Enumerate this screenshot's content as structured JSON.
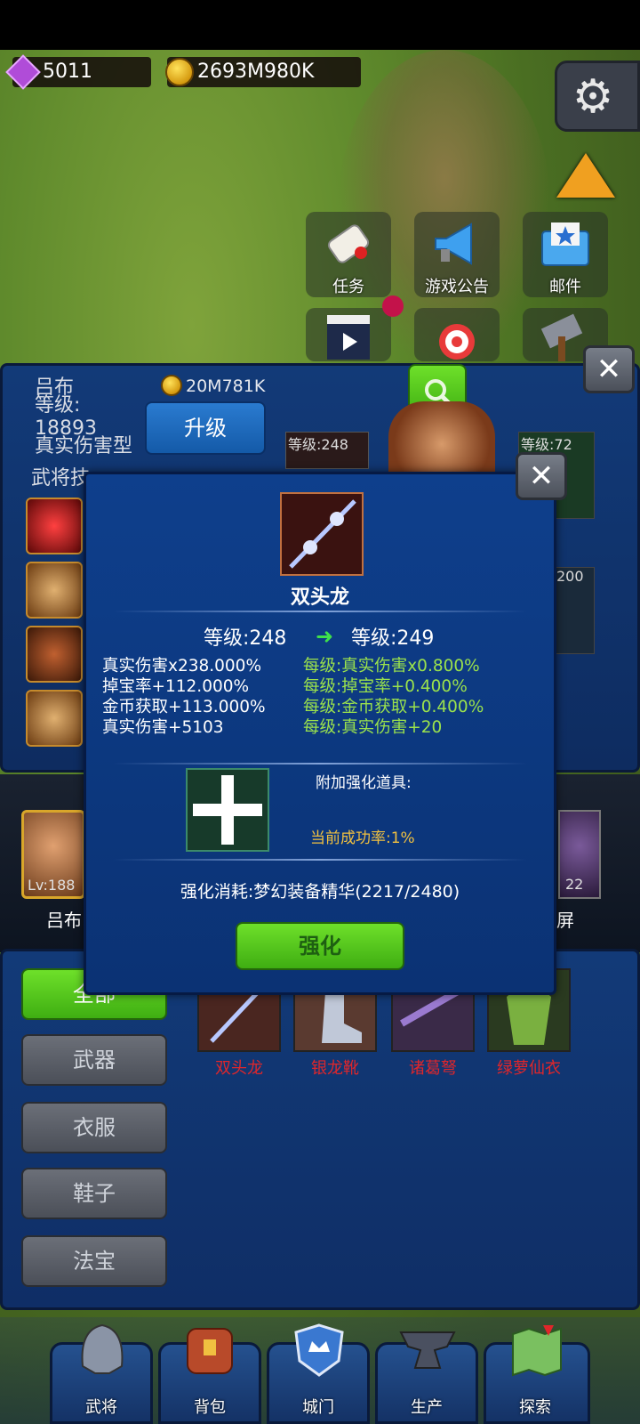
{
  "resources": {
    "gems": "5011",
    "gold": "2693M980K"
  },
  "menu_tiles": [
    {
      "label": "任务",
      "icon": "scroll-icon"
    },
    {
      "label": "游戏公告",
      "icon": "megaphone-icon"
    },
    {
      "label": "邮件",
      "icon": "mail-icon"
    }
  ],
  "hero": {
    "name": "吕布",
    "level_label": "等级:",
    "level_value": "18893",
    "type": "真实伤害型",
    "partial_label": "武将技",
    "upgrade_cost": "20M781K",
    "upgrade_button": "升级"
  },
  "equip_cards": [
    {
      "level": "等级:248"
    },
    {
      "level": "等级:72"
    },
    {
      "level": "200"
    }
  ],
  "hero_strip": {
    "name": "吕布",
    "level": "Lv:188",
    "right_partial": "屏",
    "right_level": "22"
  },
  "modal": {
    "item_name": "双头龙",
    "level_from": "等级:248",
    "level_to": "等级:249",
    "stats_current": [
      "真实伤害x238.000%",
      "掉宝率+112.000%",
      "金币获取+113.000%",
      "真实伤害+5103"
    ],
    "stats_per_level": [
      "每级:真实伤害x0.800%",
      "每级:掉宝率+0.400%",
      "每级:金币获取+0.400%",
      "每级:真实伤害+20"
    ],
    "extra_item_label": "附加强化道具:",
    "success_rate": "当前成功率:1%",
    "cost": "强化消耗:梦幻装备精华(2217/2480)",
    "enhance_button": "强化"
  },
  "categories": [
    "全部",
    "武器",
    "衣服",
    "鞋子",
    "法宝"
  ],
  "inventory": [
    {
      "name": "双头龙"
    },
    {
      "name": "银龙靴"
    },
    {
      "name": "诸葛弩"
    },
    {
      "name": "绿萝仙衣"
    }
  ],
  "nav": [
    "武将",
    "背包",
    "城门",
    "生产",
    "探索"
  ],
  "colors": {
    "modal_bg": "#0e3f8c",
    "green_text": "#9be24c",
    "gold_text": "#f0c040",
    "item_red": "#e0262a"
  }
}
